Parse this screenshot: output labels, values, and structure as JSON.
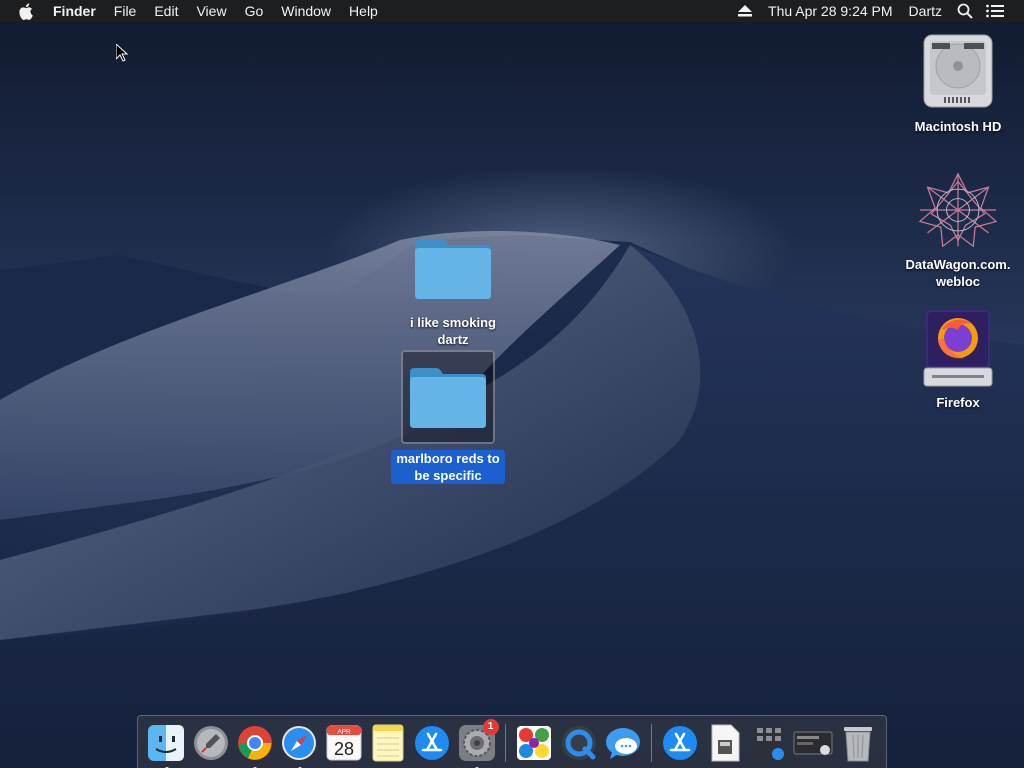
{
  "menubar": {
    "app_name": "Finder",
    "menus": [
      "File",
      "Edit",
      "View",
      "Go",
      "Window",
      "Help"
    ],
    "datetime": "Thu Apr 28  9:24 PM",
    "user": "Dartz",
    "icons": [
      "apple-icon",
      "eject-icon",
      "spotlight-search-icon",
      "notification-center-icon"
    ]
  },
  "desktop": {
    "folders": [
      {
        "label": "i like smoking dartz",
        "selected": false
      },
      {
        "label": "marlboro reds to be specific",
        "selected": true
      }
    ],
    "right_icons": [
      {
        "label": "Macintosh HD",
        "icon": "hard-drive-icon"
      },
      {
        "label": "DataWagon.com.webloc",
        "line1": "DataWagon.com.",
        "line2": "webloc",
        "icon": "webloc-icon"
      },
      {
        "label": "Firefox",
        "icon": "firefox-disk-icon"
      }
    ]
  },
  "dock": {
    "badge_count": "1",
    "calendar_month": "APR",
    "calendar_day": "28",
    "items": [
      "finder-icon",
      "launchpad-icon",
      "chrome-icon",
      "safari-icon",
      "calendar-icon",
      "notes-icon",
      "app-store-icon",
      "system-preferences-icon",
      "game-icon",
      "quicktime-icon",
      "messages-icon",
      "app-store-downloads-icon",
      "documents-icon",
      "applications-folder-icon",
      "screenshots-icon",
      "trash-icon"
    ]
  },
  "colors": {
    "selection": "#1c5fd1",
    "folder": "#5fb1e6",
    "menubar": "#1e1e20"
  }
}
